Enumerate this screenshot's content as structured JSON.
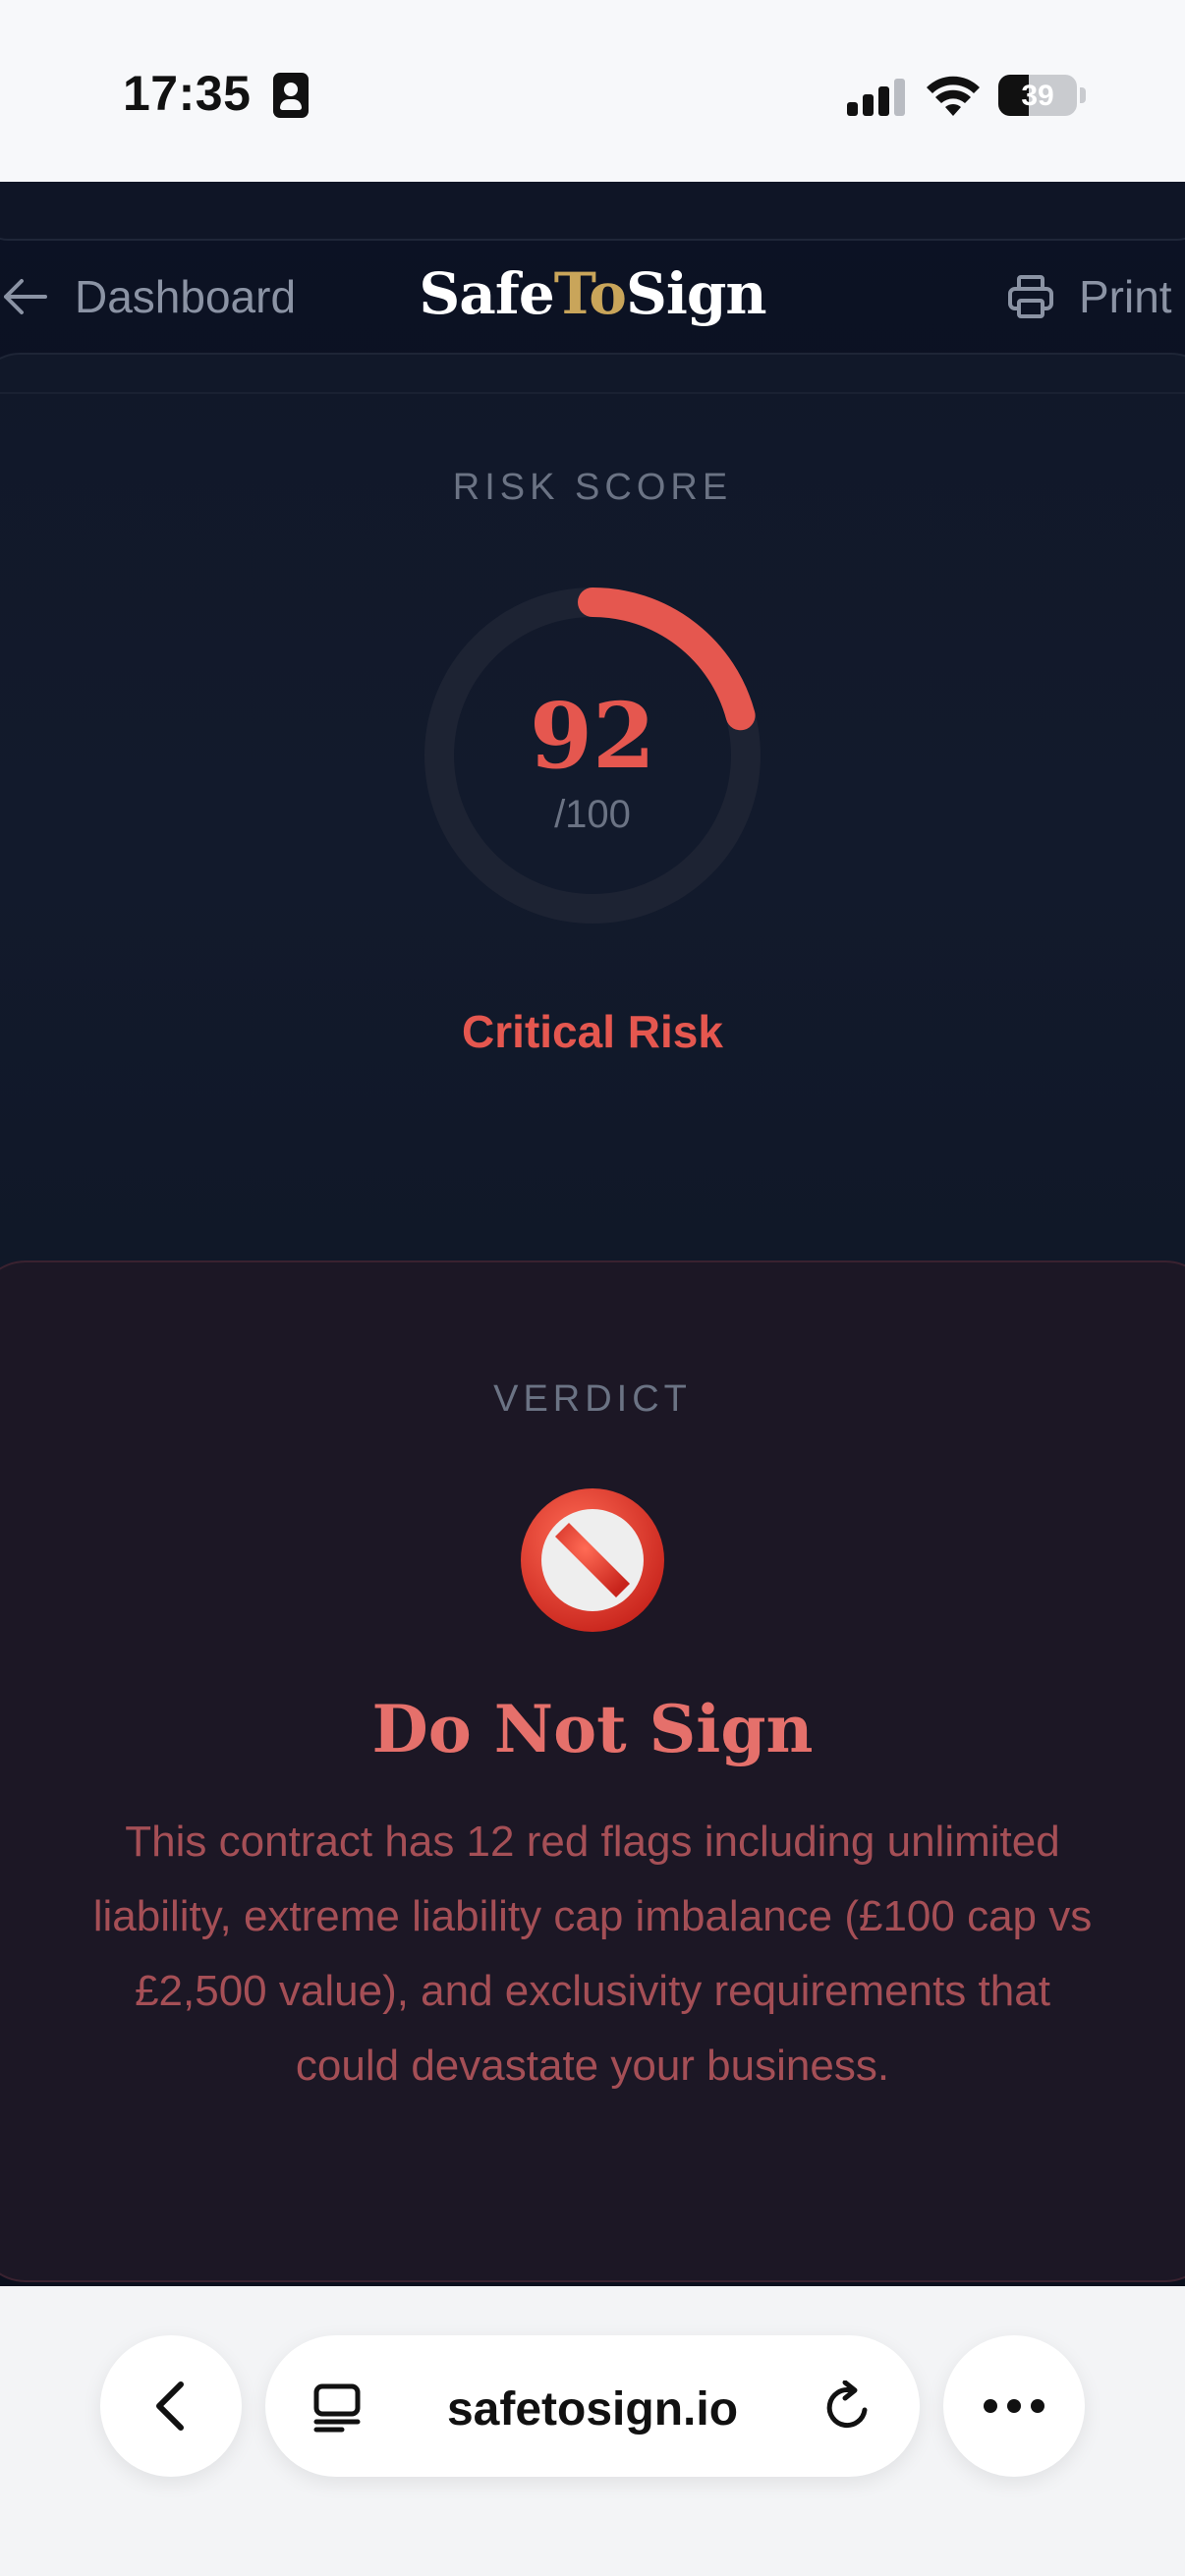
{
  "status_bar": {
    "time": "17:35",
    "battery": "39"
  },
  "nav": {
    "back_label": "Dashboard",
    "brand": {
      "part1": "Safe",
      "part2": "To",
      "part3": "Sign"
    },
    "print_label": "Print"
  },
  "risk_score": {
    "label": "RISK SCORE",
    "value": "92",
    "max": "/100",
    "level": "Critical Risk",
    "score_fraction": 0.92
  },
  "verdict": {
    "label": "VERDICT",
    "icon": "prohibited-icon",
    "title": "Do Not Sign",
    "description": "This contract has 12 red flags including unlimited liability, extreme liability cap imbalance (£100 cap vs £2,500 value), and exclusivity requirements that could devastate your business."
  },
  "browser": {
    "url": "safetosign.io"
  },
  "colors": {
    "accent_red": "#e5574f",
    "brand_gold": "#c9a55a",
    "background": "#0b1020"
  }
}
